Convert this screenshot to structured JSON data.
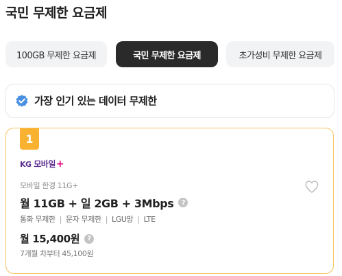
{
  "page": {
    "title": "국민 무제한 요금제"
  },
  "tabs": [
    {
      "label": "100GB 무제한 요금제",
      "active": false
    },
    {
      "label": "국민 무제한 요금제",
      "active": true
    },
    {
      "label": "초가성비 무제한 요금제",
      "active": false
    }
  ],
  "popular": {
    "icon": "verified-badge-icon",
    "text": "가장 인기 있는 데이터 무제한"
  },
  "card": {
    "rank": "1",
    "brand": {
      "prefix": "KG",
      "name": "모바일",
      "suffix": "+"
    },
    "plan_name": "모바일 한경 11G+",
    "data": "월 11GB + 일 2GB + 3Mbps",
    "features": [
      "통화 무제한",
      "문자 무제한",
      "LGU망",
      "LTE"
    ],
    "feature_separator": "|",
    "price": "월 15,400원",
    "after_price": "7개월 차부터 45,100원",
    "help_glyph": "?"
  },
  "colors": {
    "accent": "#f9b230",
    "brand": "#5b2e90",
    "badge": "#4a90e2",
    "active_tab": "#2a2a2a"
  }
}
